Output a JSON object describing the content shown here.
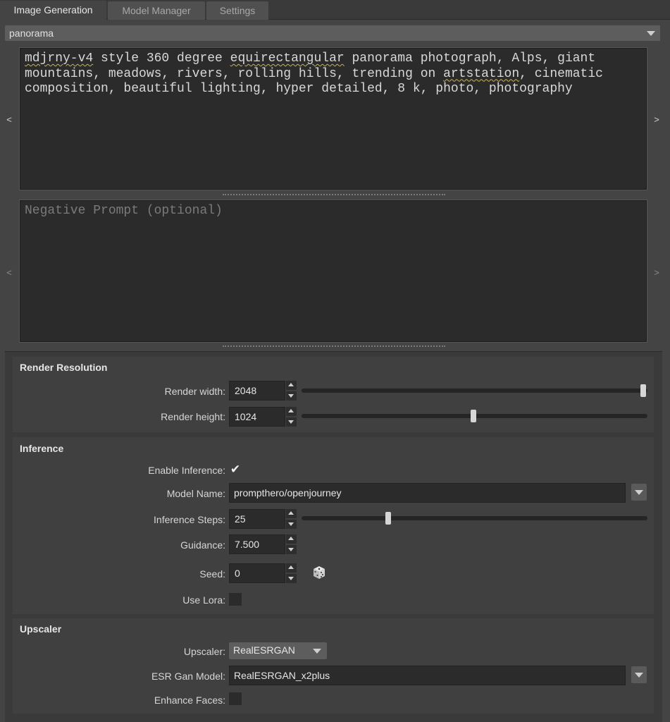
{
  "tabs": [
    {
      "label": "Image Generation",
      "active": true
    },
    {
      "label": "Model Manager",
      "active": false
    },
    {
      "label": "Settings",
      "active": false
    }
  ],
  "preset": {
    "value": "panorama"
  },
  "prompt": {
    "segments": [
      "mdjrny-v4",
      " style 360 degree ",
      "equirectangular",
      " panorama photograph, Alps, giant mountains, meadows, rivers, rolling hills, trending on ",
      "artstation",
      ", cinematic composition, beautiful lighting, hyper detailed, 8 k, photo, photography"
    ],
    "prev_arrow": "<",
    "next_arrow": ">"
  },
  "negative_prompt": {
    "placeholder": "Negative Prompt (optional)",
    "prev_arrow": "<",
    "next_arrow": ">"
  },
  "render_resolution": {
    "title": "Render Resolution",
    "width_label": "Render width:",
    "width_value": "2048",
    "width_slider_fraction": 1.0,
    "height_label": "Render height:",
    "height_value": "1024",
    "height_slider_fraction": 0.5
  },
  "inference": {
    "title": "Inference",
    "enable_label": "Enable Inference:",
    "enable_checked": true,
    "enable_mark": "✔",
    "model_label": "Model Name:",
    "model_value": "prompthero/openjourney",
    "steps_label": "Inference Steps:",
    "steps_value": "25",
    "steps_slider_fraction": 0.25,
    "guidance_label": "Guidance:",
    "guidance_value": "7.500",
    "seed_label": "Seed:",
    "seed_value": "0",
    "seed_icon": "dice-icon",
    "lora_label": "Use Lora:",
    "lora_checked": false
  },
  "upscaler": {
    "title": "Upscaler",
    "upscaler_label": "Upscaler:",
    "upscaler_value": "RealESRGAN",
    "model_label": "ESR Gan Model:",
    "model_value": "RealESRGAN_x2plus",
    "faces_label": "Enhance Faces:",
    "faces_checked": false
  },
  "colors": {
    "background": "#444444",
    "panel": "#3a3a3a",
    "field": "#2b2b2b",
    "accent_check": "#f0f0f0"
  }
}
